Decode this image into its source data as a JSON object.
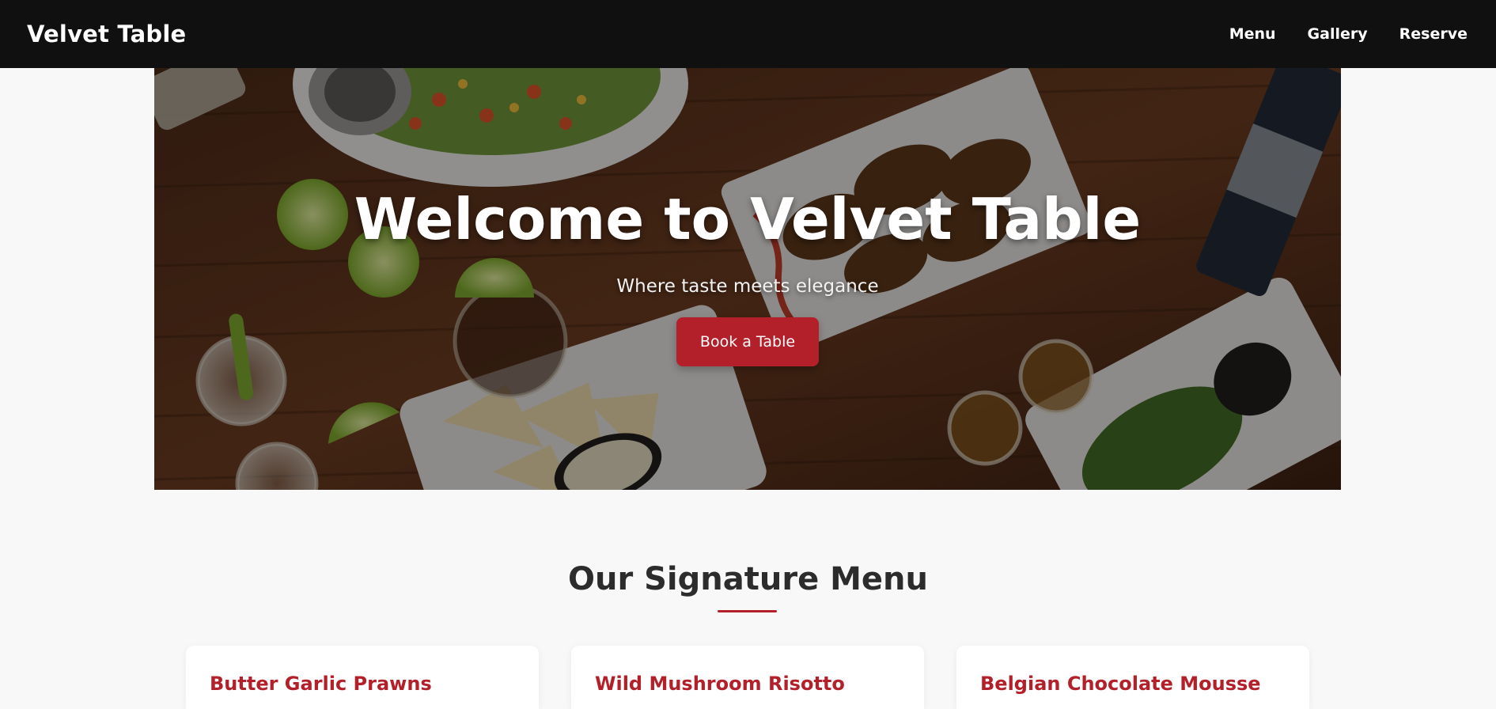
{
  "brand": {
    "name": "Velvet Table"
  },
  "nav": {
    "items": [
      {
        "label": "Menu"
      },
      {
        "label": "Gallery"
      },
      {
        "label": "Reserve"
      }
    ]
  },
  "hero": {
    "title": "Welcome to Velvet Table",
    "subtitle": "Where taste meets elegance",
    "cta_label": "Book a Table"
  },
  "menu": {
    "title": "Our Signature Menu",
    "items": [
      {
        "name": "Butter Garlic Prawns"
      },
      {
        "name": "Wild Mushroom Risotto"
      },
      {
        "name": "Belgian Chocolate Mousse"
      }
    ]
  },
  "colors": {
    "nav_bg": "#101010",
    "accent": "#b3202a",
    "page_bg": "#f8f8f8"
  }
}
